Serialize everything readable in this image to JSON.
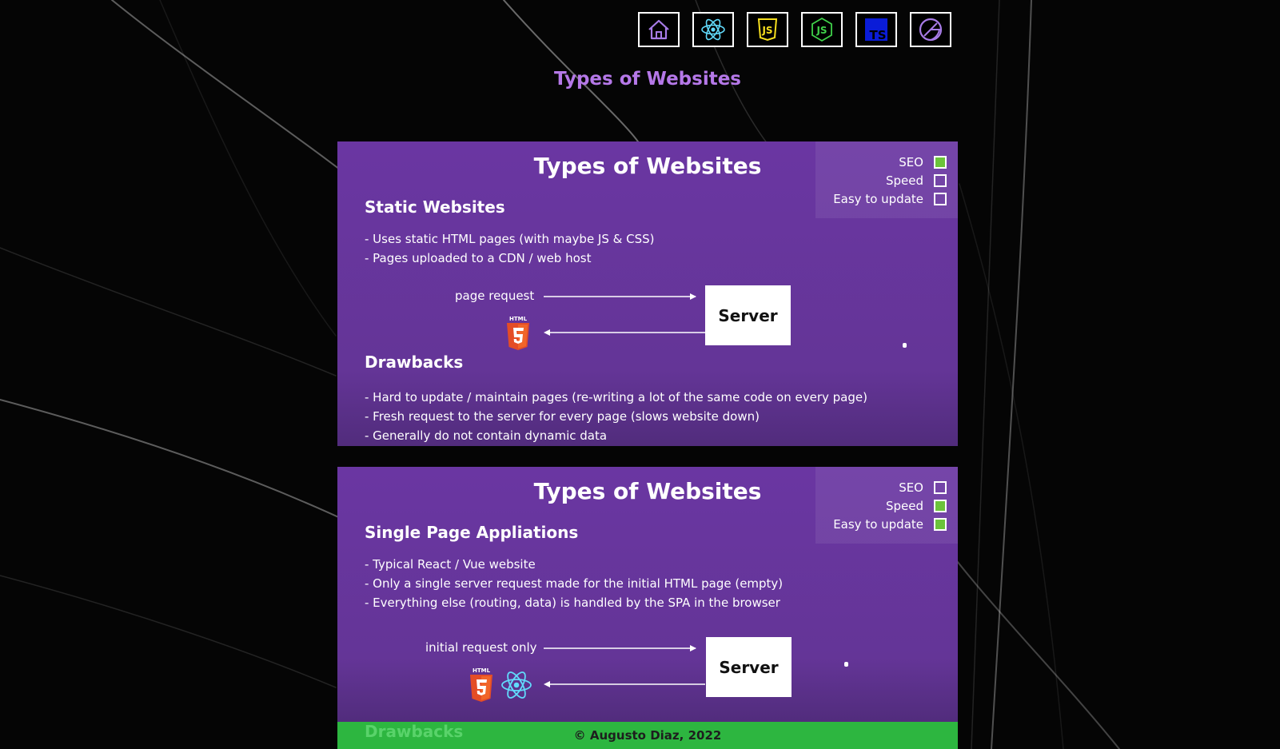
{
  "nav": {
    "items": [
      {
        "name": "home",
        "icon": "home-icon"
      },
      {
        "name": "react",
        "icon": "react-icon"
      },
      {
        "name": "javascript",
        "icon": "js-icon",
        "text": "JS"
      },
      {
        "name": "nodejs",
        "icon": "nodejs-icon",
        "text": "JS"
      },
      {
        "name": "typescript",
        "icon": "typescript-icon",
        "text": "TS"
      },
      {
        "name": "gatsby",
        "icon": "gatsby-icon"
      }
    ]
  },
  "page_title": "Types of Websites",
  "colors": {
    "accent": "#b578e8",
    "slide_bg": "#6a36a2",
    "check_on": "#6bc33b",
    "footer_bg": "#2db640",
    "html5_orange": "#e44d26",
    "react_blue": "#61dafb"
  },
  "slides": [
    {
      "title": "Types of Websites",
      "checks": [
        {
          "label": "SEO",
          "checked": true
        },
        {
          "label": "Speed",
          "checked": false
        },
        {
          "label": "Easy to update",
          "checked": false
        }
      ],
      "heading": "Static Websites",
      "bullets": [
        "- Uses static HTML pages (with maybe JS & CSS)",
        "- Pages uploaded to a CDN / web host"
      ],
      "request_label": "page request",
      "server_label": "Server",
      "html5_tag": "HTML",
      "drawbacks_heading": "Drawbacks",
      "drawbacks": [
        "- Hard to update / maintain pages (re-writing a lot of the same code on every page)",
        "- Fresh request to the server for every page (slows website down)",
        "- Generally do not contain dynamic data"
      ]
    },
    {
      "title": "Types of Websites",
      "checks": [
        {
          "label": "SEO",
          "checked": false
        },
        {
          "label": "Speed",
          "checked": true
        },
        {
          "label": "Easy to update",
          "checked": true
        }
      ],
      "heading": "Single Page Appliations",
      "bullets": [
        "- Typical React / Vue website",
        "- Only a single server request made for the initial HTML page (empty)",
        "- Everything else (routing, data) is handled by the SPA in the browser"
      ],
      "request_label": "initial request only",
      "server_label": "Server",
      "html5_tag": "HTML",
      "drawbacks_heading": "Drawbacks"
    }
  ],
  "footer": {
    "text": "© Augusto Diaz, 2022"
  }
}
